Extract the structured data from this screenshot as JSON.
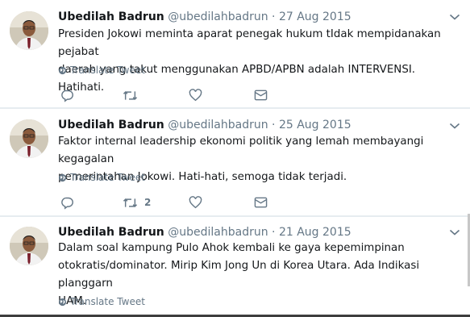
{
  "translate_label": "Translate Tweet",
  "tweets": [
    {
      "name": "Ubedilah Badrun",
      "handle": "@ubedilahbadrun",
      "dot": "·",
      "date": "27 Aug 2015",
      "lines": [
        "Presiden Jokowi meminta aparat penegak hukum tIdak mempidanakan pejabat",
        "daerah yang takut menggunakan APBD/APBN adalah INTERVENSI. Hatihati."
      ],
      "retweets": ""
    },
    {
      "name": "Ubedilah Badrun",
      "handle": "@ubedilahbadrun",
      "dot": "·",
      "date": "25 Aug 2015",
      "lines": [
        "Faktor internal leadership ekonomi politik yang lemah membayangi kegagalan",
        "pemerintahan Jokowi. Hati-hati, semoga tidak terjadi."
      ],
      "retweets": "2"
    },
    {
      "name": "Ubedilah Badrun",
      "handle": "@ubedilahbadrun",
      "dot": "·",
      "date": "21 Aug 2015",
      "lines": [
        "Dalam soal kampung Pulo Ahok kembali ke gaya kepemimpinan",
        "otokratis/dominator. Mirip Kim Jong Un di Korea Utara. Ada Indikasi planggarn",
        "HAM."
      ],
      "retweets": ""
    }
  ],
  "colors": {
    "text": "#14171a",
    "muted": "#657786",
    "separator": "#e6ecf0"
  },
  "icons": [
    "avatar",
    "chevron-down-icon",
    "globe-icon",
    "reply-icon",
    "retweet-icon",
    "like-icon",
    "direct-message-icon"
  ]
}
